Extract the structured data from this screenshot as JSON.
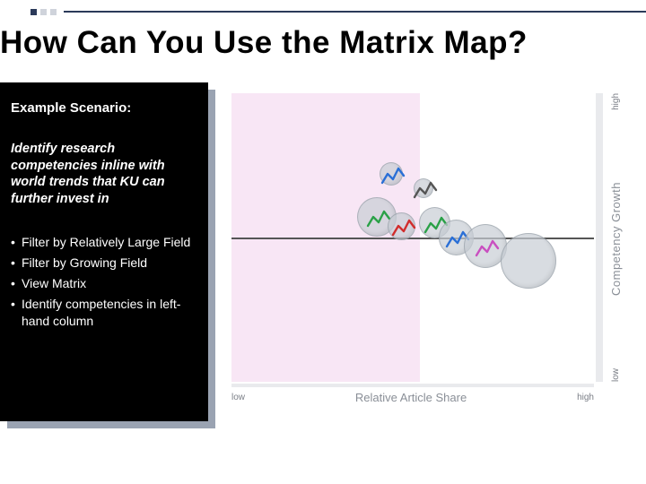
{
  "title": "How Can You Use the Matrix Map?",
  "panel": {
    "scenario_label": "Example Scenario:",
    "description": "Identify research competencies inline with world trends that KU can further invest in",
    "steps": [
      "Filter by Relatively Large Field",
      "Filter by Growing Field",
      "View Matrix",
      "Identify competencies in left-hand column"
    ]
  },
  "chart_data": {
    "type": "scatter",
    "title": "",
    "xlabel": "Relative Article Share",
    "ylabel": "Competency Growth",
    "xlim": [
      0,
      100
    ],
    "ylim": [
      0,
      100
    ],
    "x_ticks": {
      "low": "low",
      "high": "high"
    },
    "y_ticks": {
      "low": "low",
      "high": "high"
    },
    "left_half_highlighted": true,
    "series": [
      {
        "name": "bubble",
        "x": 44,
        "y": 72,
        "r": 6,
        "spark_color": "#2a6fd6"
      },
      {
        "name": "bubble",
        "x": 53,
        "y": 67,
        "r": 5,
        "spark_color": "#555555"
      },
      {
        "name": "bubble",
        "x": 40,
        "y": 57,
        "r": 10,
        "spark_color": "#2aa147"
      },
      {
        "name": "bubble",
        "x": 47,
        "y": 54,
        "r": 7,
        "spark_color": "#d12d2d"
      },
      {
        "name": "bubble",
        "x": 56,
        "y": 55,
        "r": 8,
        "spark_color": "#2aa147"
      },
      {
        "name": "bubble",
        "x": 62,
        "y": 50,
        "r": 9,
        "spark_color": "#2a6fd6"
      },
      {
        "name": "bubble",
        "x": 70,
        "y": 47,
        "r": 11,
        "spark_color": "#c94fc0"
      },
      {
        "name": "bubble",
        "x": 82,
        "y": 42,
        "r": 14,
        "spark_color": null
      }
    ]
  }
}
